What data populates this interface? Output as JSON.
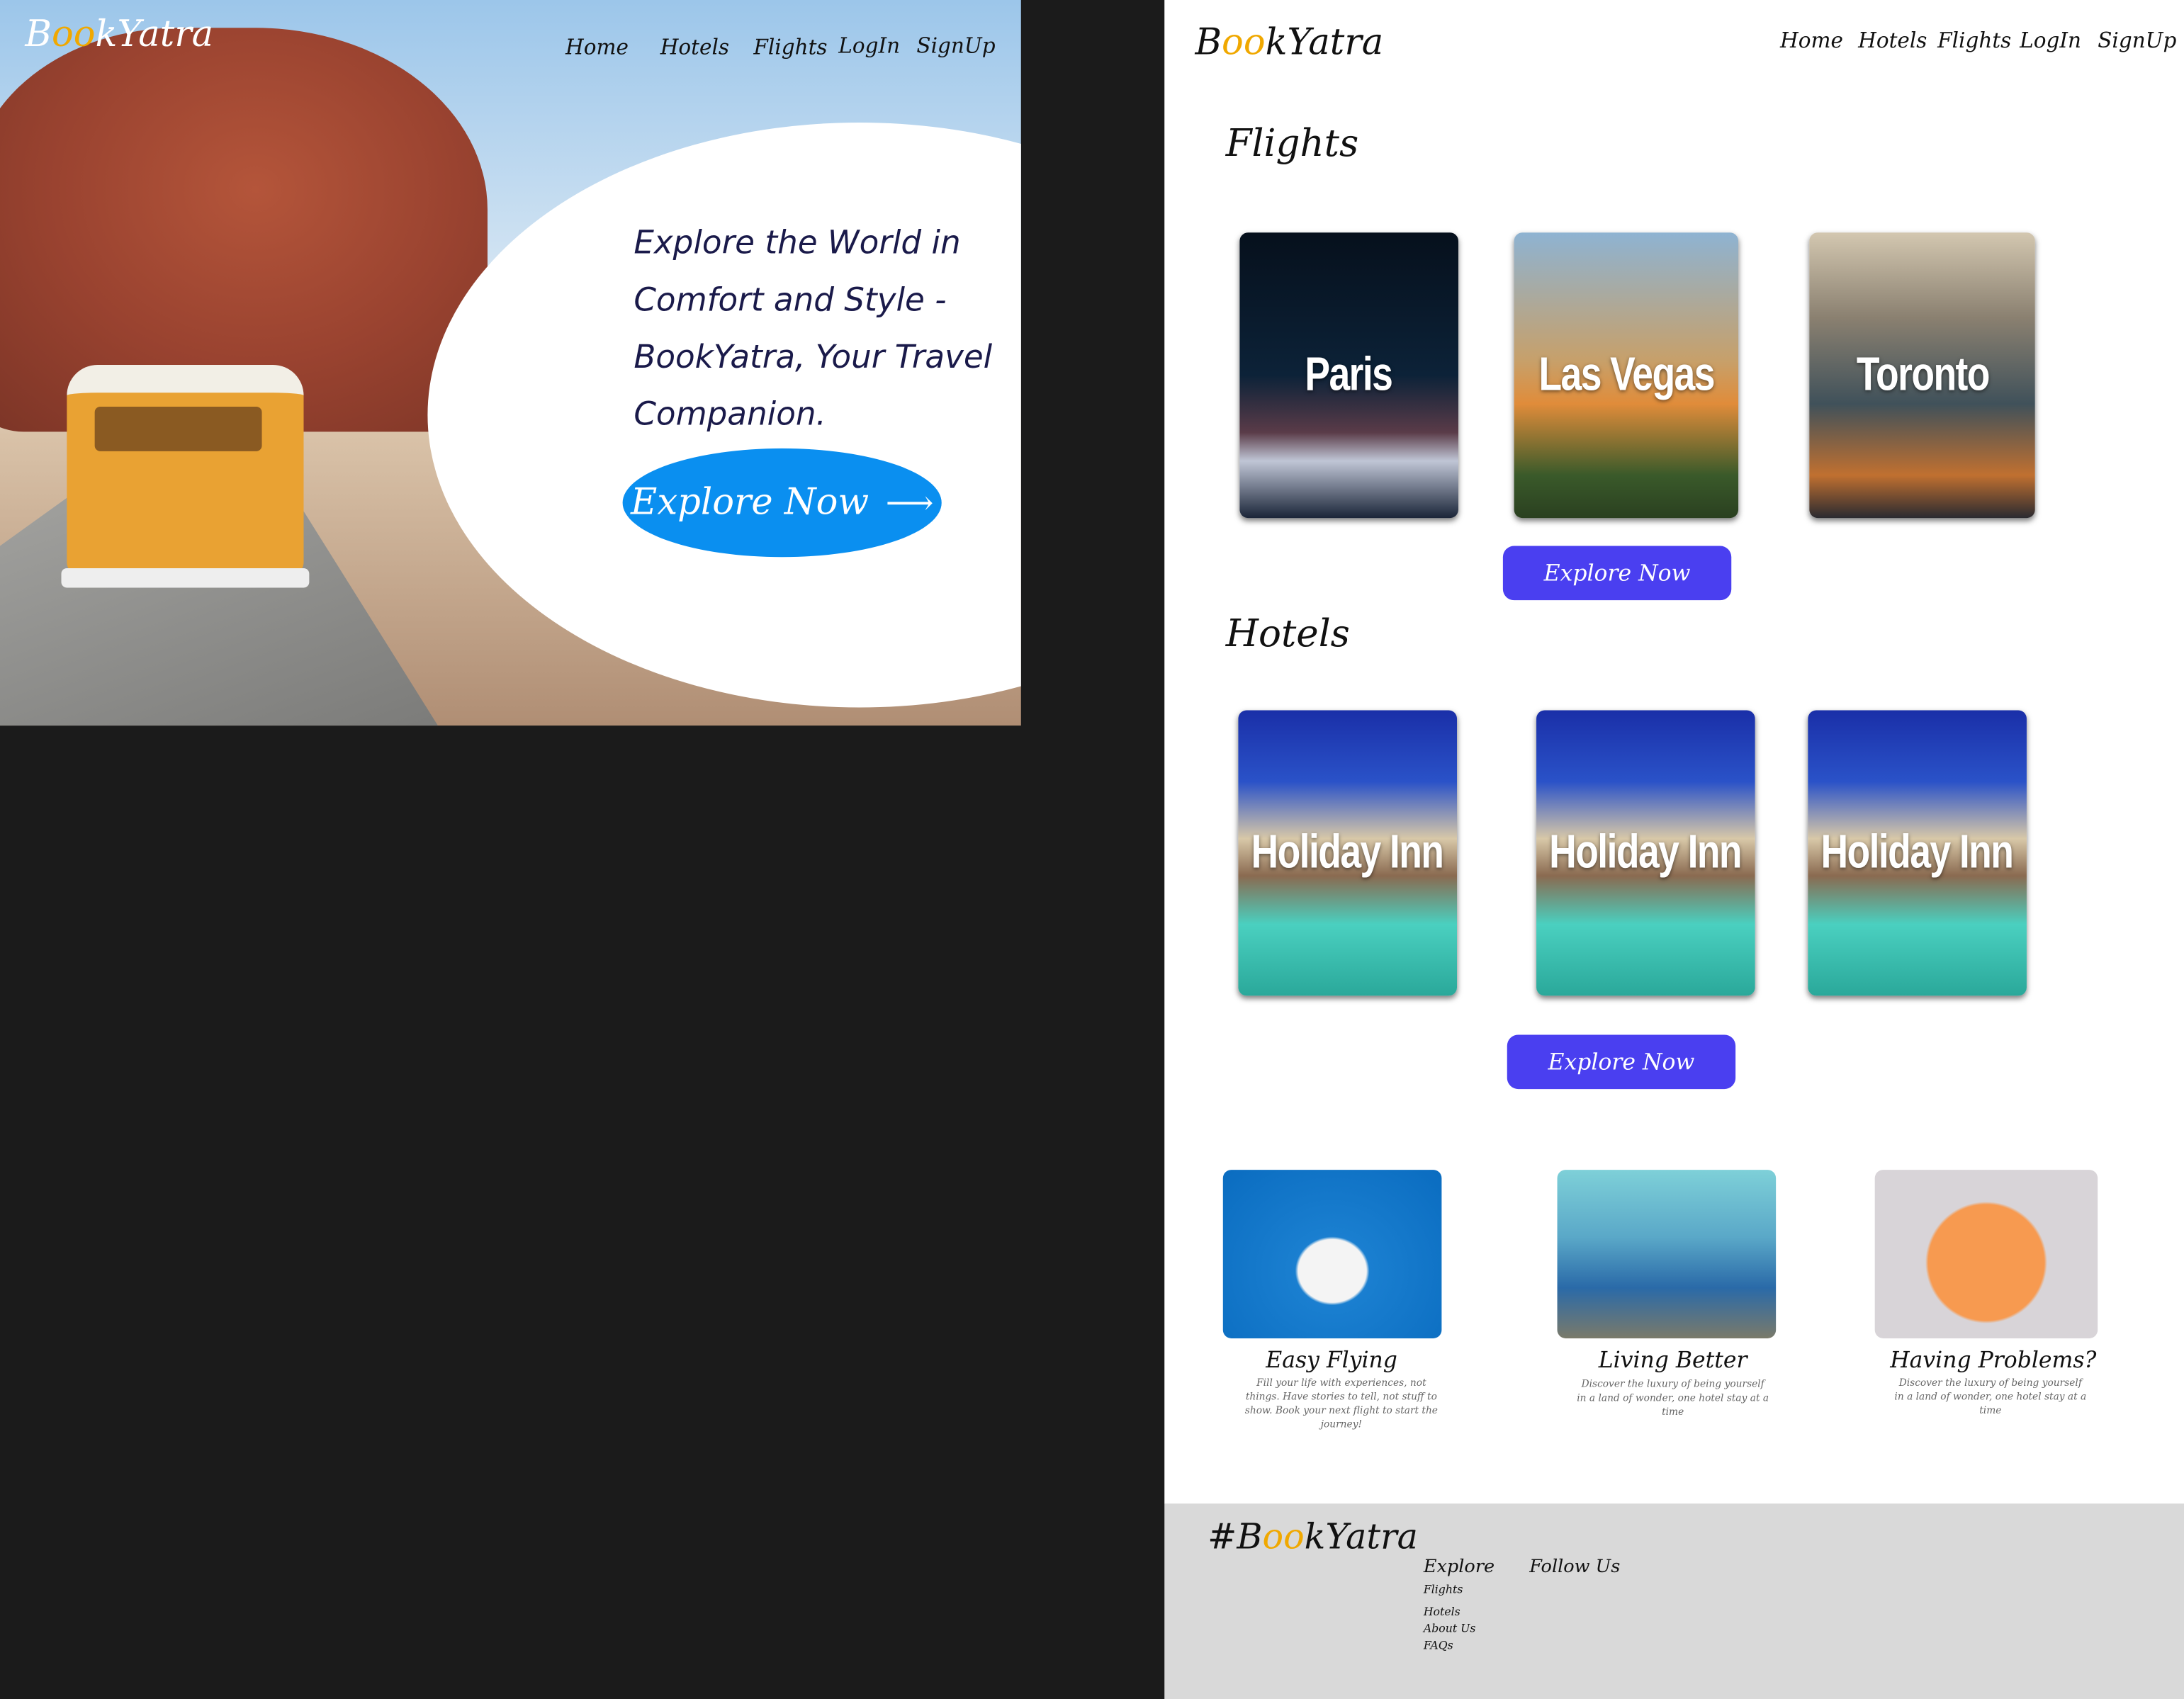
{
  "brand": {
    "pre": "B",
    "oo": "oo",
    "post": "kYatra",
    "hashtag": "#"
  },
  "nav": [
    "Home",
    "Hotels",
    "Flights",
    "LogIn",
    "SignUp"
  ],
  "hero": {
    "lines": [
      "Explore the World in",
      "Comfort and Style -",
      "BookYatra, Your Travel",
      "Companion."
    ],
    "button": "Explore Now",
    "button_icon": "arrow-right-icon"
  },
  "flights": {
    "heading": "Flights",
    "cards": [
      "Paris",
      "Las Vegas",
      "Toronto"
    ],
    "button": "Explore Now"
  },
  "hotels": {
    "heading": "Hotels",
    "cards": [
      "Holiday Inn",
      "Holiday Inn",
      "Holiday Inn"
    ],
    "button": "Explore Now"
  },
  "features": [
    {
      "title": "Easy Flying",
      "desc": "Fill your life with experiences, not things. Have stories to tell, not stuff to show. Book your next flight to start the journey!"
    },
    {
      "title": "Living Better",
      "desc": "Discover the luxury of being yourself in a land of wonder, one hotel stay at a time"
    },
    {
      "title": "Having Problems?",
      "desc": "Discover the luxury of being yourself in a land of wonder, one hotel stay at a time"
    }
  ],
  "footer": {
    "explore_heading": "Explore",
    "follow_heading": "Follow Us",
    "links": [
      "Flights",
      "Hotels",
      "About Us",
      "FAQs"
    ]
  },
  "colors": {
    "accent": "#4a3ff0",
    "hero_button": "#0a8ff0",
    "logo_o": "#f0a800",
    "footer_bg": "#d9d9d9"
  }
}
